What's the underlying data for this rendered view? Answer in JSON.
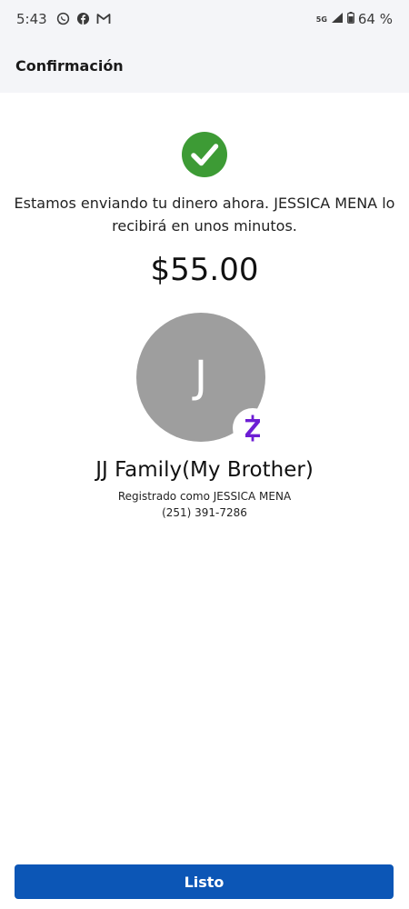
{
  "status_bar": {
    "time": "5:43",
    "network": "5G",
    "battery": "64 %",
    "icons": [
      "whatsapp-icon",
      "facebook-icon",
      "gmail-icon",
      "signal-icon",
      "battery-icon"
    ]
  },
  "header": {
    "title": "Confirmación"
  },
  "confirmation": {
    "message": "Estamos enviando tu dinero ahora. JESSICA MENA lo recibirá en unos minutos.",
    "amount": "$55.00",
    "check_color": "#3d9b35"
  },
  "recipient": {
    "initial": "J",
    "name": "JJ Family(My Brother)",
    "registered_as": "Registrado como JESSICA MENA",
    "phone": "(251) 391-7286",
    "badge_icon": "zelle-icon",
    "badge_color": "#6d1ed4"
  },
  "footer": {
    "done_label": "Listo",
    "button_color": "#0c56b6"
  }
}
